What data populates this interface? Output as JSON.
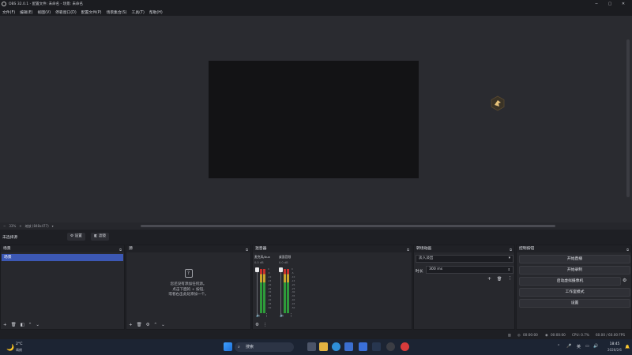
{
  "window": {
    "title": "OBS 32.0.1 - 配置文件: 未命名 - 场景: 未命名",
    "minimize": "─",
    "maximize": "▢",
    "close": "✕"
  },
  "menu": [
    "文件(F)",
    "编辑(E)",
    "视图(V)",
    "停靠窗口(D)",
    "配置文件(P)",
    "场景集合(S)",
    "工具(T)",
    "帮助(H)"
  ],
  "preview": {
    "zoom": "33%",
    "scale_label": "缩放 (848x477)"
  },
  "source_bar": {
    "no_source": "未选择源",
    "settings": "设置",
    "filters": "滤镜"
  },
  "scenes": {
    "title": "场景",
    "items": [
      "场景"
    ]
  },
  "sources": {
    "title": "源",
    "empty_line1": "您还没有添加任何源。",
    "empty_line2": "点击下面的 + 按钮,",
    "empty_line3": "或者右击此处添加一个。"
  },
  "mixer": {
    "title": "混音器",
    "channels": [
      {
        "name": "麦克风/Aux",
        "db": "0.0 dB"
      },
      {
        "name": "桌面音频",
        "db": "0.0 dB"
      }
    ],
    "scale": [
      "0",
      "-5",
      "-10",
      "-15",
      "-20",
      "-25",
      "-30",
      "-35",
      "-40",
      "-45",
      "-50",
      "-55",
      "-60"
    ]
  },
  "transitions": {
    "title": "转场动画",
    "type": "淡入淡出",
    "duration_label": "时长",
    "duration": "300 ms"
  },
  "controls": {
    "title": "控制按钮",
    "buttons": [
      "开始直播",
      "开始录制",
      "启动虚拟摄像机",
      "工作室模式",
      "设置"
    ]
  },
  "status": {
    "live_time": "00:00:00",
    "rec_time": "00:00:00",
    "cpu": "CPU: 0.7%",
    "fps": "60.00 / 60.00 FPS"
  },
  "taskbar": {
    "weather_temp": "2°C",
    "weather_text": "晴朗",
    "search": "搜索",
    "ime": "英",
    "time": "18:45",
    "date": "2026/2/6"
  },
  "colors": {
    "accent": "#3c58b4",
    "bg": "#1e1f24"
  }
}
